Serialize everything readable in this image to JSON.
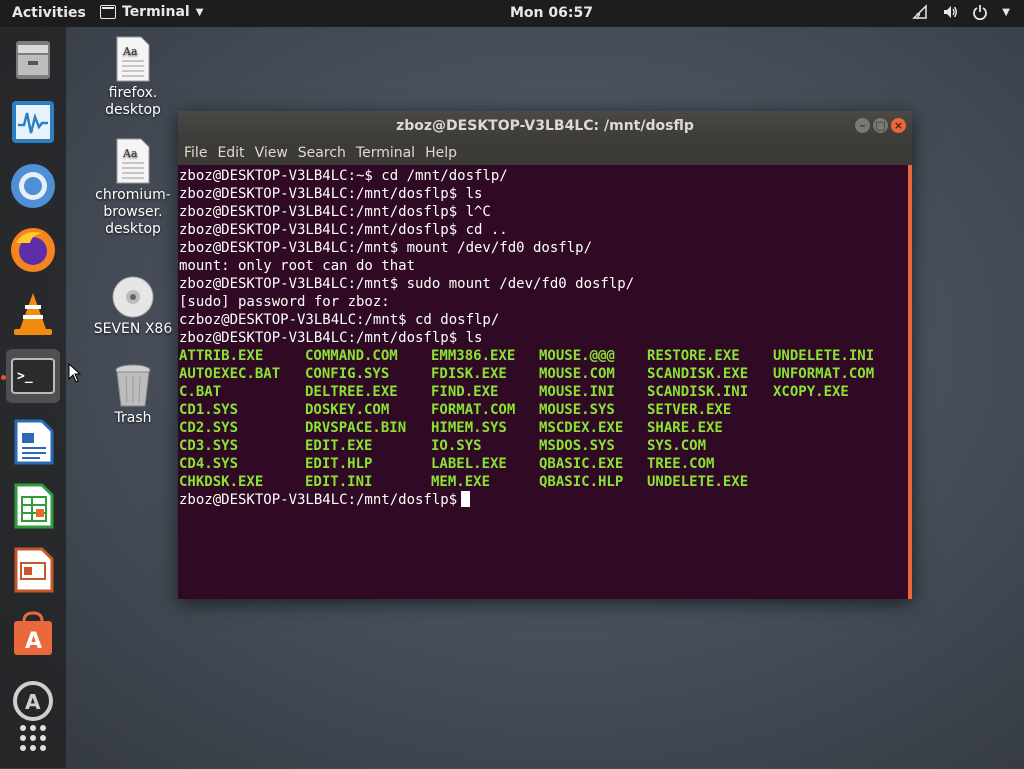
{
  "topbar": {
    "activities": "Activities",
    "app_menu": "Terminal",
    "clock": "Mon 06:57"
  },
  "dock": {
    "items": [
      "files-icon",
      "system-monitor-icon",
      "chromium-icon",
      "firefox-icon",
      "vlc-icon",
      "terminal-icon",
      "writer-icon",
      "calc-icon",
      "impress-icon",
      "software-center-icon",
      "software-updater-icon",
      "show-applications-icon"
    ]
  },
  "desktop": {
    "icons": [
      {
        "label": "firefox.\ndesktop"
      },
      {
        "label": "chromium-\nbrowser.\ndesktop"
      },
      {
        "label": "SEVEN X86"
      },
      {
        "label": "Trash"
      }
    ]
  },
  "terminal": {
    "title": "zboz@DESKTOP-V3LB4LC: /mnt/dosflp",
    "menu": [
      "File",
      "Edit",
      "View",
      "Search",
      "Terminal",
      "Help"
    ],
    "lines": [
      "zboz@DESKTOP-V3LB4LC:~$ cd /mnt/dosflp/",
      "zboz@DESKTOP-V3LB4LC:/mnt/dosflp$ ls",
      "zboz@DESKTOP-V3LB4LC:/mnt/dosflp$ l^C",
      "zboz@DESKTOP-V3LB4LC:/mnt/dosflp$ cd ..",
      "zboz@DESKTOP-V3LB4LC:/mnt$ mount /dev/fd0 dosflp/",
      "mount: only root can do that",
      "zboz@DESKTOP-V3LB4LC:/mnt$ sudo mount /dev/fd0 dosflp/",
      "[sudo] password for zboz:",
      "czboz@DESKTOP-V3LB4LC:/mnt$ cd dosflp/",
      "zboz@DESKTOP-V3LB4LC:/mnt/dosflp$ ls"
    ],
    "ls_rows": [
      [
        "ATTRIB.EXE",
        "COMMAND.COM",
        "EMM386.EXE",
        "MOUSE.@@@",
        "RESTORE.EXE",
        "UNDELETE.INI"
      ],
      [
        "AUTOEXEC.BAT",
        "CONFIG.SYS",
        "FDISK.EXE",
        "MOUSE.COM",
        "SCANDISK.EXE",
        "UNFORMAT.COM"
      ],
      [
        "C.BAT",
        "DELTREE.EXE",
        "FIND.EXE",
        "MOUSE.INI",
        "SCANDISK.INI",
        "XCOPY.EXE"
      ],
      [
        "CD1.SYS",
        "DOSKEY.COM",
        "FORMAT.COM",
        "MOUSE.SYS",
        "SETVER.EXE",
        ""
      ],
      [
        "CD2.SYS",
        "DRVSPACE.BIN",
        "HIMEM.SYS",
        "MSCDEX.EXE",
        "SHARE.EXE",
        ""
      ],
      [
        "CD3.SYS",
        "EDIT.EXE",
        "IO.SYS",
        "MSDOS.SYS",
        "SYS.COM",
        ""
      ],
      [
        "CD4.SYS",
        "EDIT.HLP",
        "LABEL.EXE",
        "QBASIC.EXE",
        "TREE.COM",
        ""
      ],
      [
        "CHKDSK.EXE",
        "EDIT.INI",
        "MEM.EXE",
        "QBASIC.HLP",
        "UNDELETE.EXE",
        ""
      ]
    ],
    "prompt": "zboz@DESKTOP-V3LB4LC:/mnt/dosflp$",
    "ls_color": "#8ae234",
    "background": "#300a24"
  }
}
